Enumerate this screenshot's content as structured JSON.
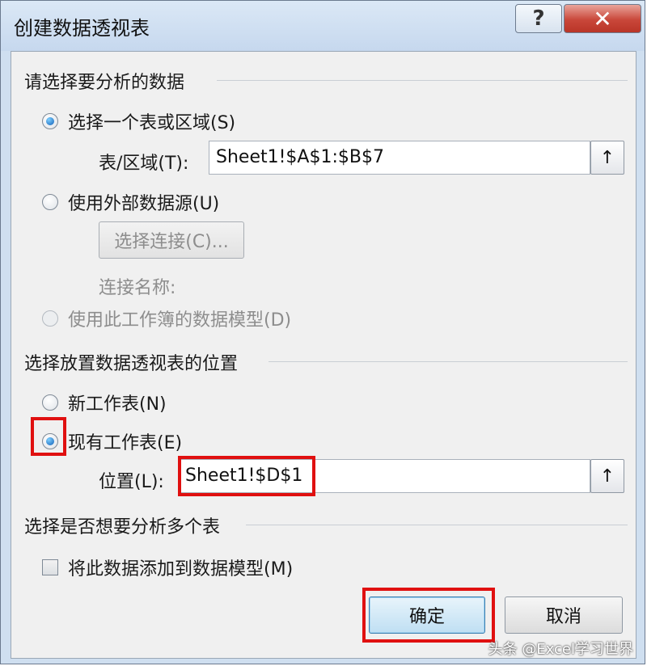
{
  "dialog": {
    "title": "创建数据透视表",
    "help_glyph": "?",
    "close_glyph": "✕"
  },
  "source": {
    "section_title": "请选择要分析的数据",
    "option_table": "选择一个表或区域(S)",
    "range_label": "表/区域(T):",
    "range_value": "Sheet1!$A$1:$B$7",
    "option_external": "使用外部数据源(U)",
    "choose_connection_button": "选择连接(C)...",
    "connection_name_label": "连接名称:",
    "option_data_model": "使用此工作簿的数据模型(D)"
  },
  "placement": {
    "section_title": "选择放置数据透视表的位置",
    "option_new_sheet": "新工作表(N)",
    "option_existing_sheet": "现有工作表(E)",
    "location_label": "位置(L):",
    "location_value": "Sheet1!$D$1"
  },
  "multi": {
    "section_title": "选择是否想要分析多个表",
    "add_to_model": "将此数据添加到数据模型(M)"
  },
  "buttons": {
    "ok": "确定",
    "cancel": "取消"
  },
  "watermark": "头条 @Excel学习世界",
  "icons": {
    "collapse": "↑"
  }
}
